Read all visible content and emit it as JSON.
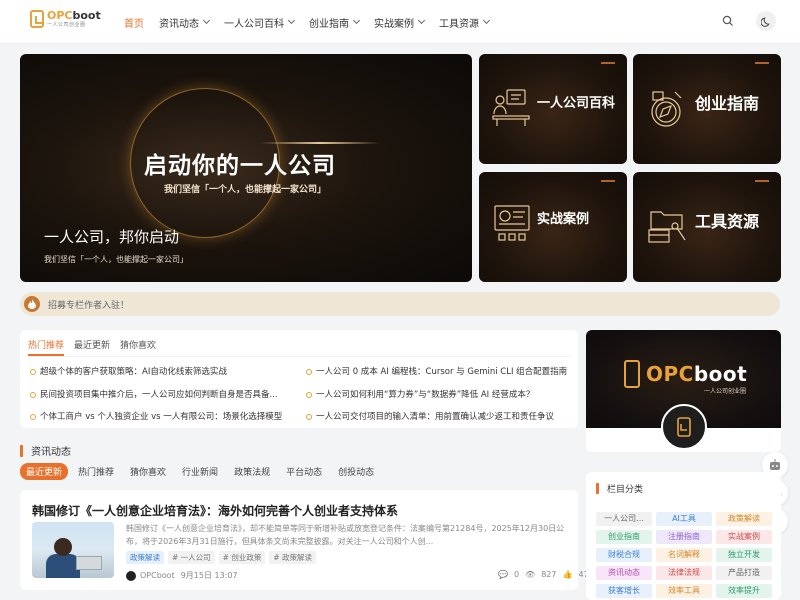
{
  "header": {
    "logo": {
      "brand_prefix": "OPC",
      "brand_suffix": "boot",
      "tagline": "一人公司创业圈"
    },
    "nav": [
      {
        "label": "首页",
        "active": true,
        "has_dropdown": false
      },
      {
        "label": "资讯动态",
        "active": false,
        "has_dropdown": true
      },
      {
        "label": "一人公司百科",
        "active": false,
        "has_dropdown": true
      },
      {
        "label": "创业指南",
        "active": false,
        "has_dropdown": true
      },
      {
        "label": "实战案例",
        "active": false,
        "has_dropdown": true
      },
      {
        "label": "工具资源",
        "active": false,
        "has_dropdown": true
      }
    ],
    "icons": {
      "search": "search-icon",
      "theme": "moon-icon"
    }
  },
  "colors": {
    "accent": "#e8712c",
    "brand_gold": "#e8a23a",
    "banner_dark": "#1c140d"
  },
  "banner": {
    "title": "启动你的一人公司",
    "subtitle": "我们坚信「一个人，也能撑起一家公司」",
    "caption": "一人公司，邦你启动",
    "caption_sub": "我们坚信「一个人，也能撑起一家公司」"
  },
  "tiles": [
    {
      "label": "一人公司百科",
      "icon": "worker-desk-icon"
    },
    {
      "label": "创业指南",
      "icon": "compass-icon"
    },
    {
      "label": "实战案例",
      "icon": "dashboard-icon"
    },
    {
      "label": "工具资源",
      "icon": "toolbox-icon"
    }
  ],
  "notice": {
    "icon": "flame-icon",
    "text": "招募专栏作者入驻！"
  },
  "hot": {
    "tabs": [
      {
        "label": "热门推荐",
        "active": true
      },
      {
        "label": "最近更新",
        "active": false
      },
      {
        "label": "猜你喜欢",
        "active": false
      }
    ],
    "items": [
      "超级个体的客户获取策略：AI自动化线索筛选实战",
      "一人公司 0 成本 AI 编程栈：Cursor 与 Gemini CLI 组合配置指南",
      "民间投资项目集中推介后，一人公司应如何判断自身是否具备...",
      "一人公司如何利用“算力券”与“数据券”降低 AI 经营成本？",
      "个体工商户 vs 个人独资企业 vs 一人有限公司：场景化选择模型",
      "一人公司交付项目的输入清单：用前置确认减少返工和责任争议"
    ]
  },
  "news": {
    "section_title": "资讯动态",
    "tabs": [
      {
        "label": "最近更新",
        "active": true
      },
      {
        "label": "热门推荐",
        "active": false
      },
      {
        "label": "猜你喜欢",
        "active": false
      },
      {
        "label": "行业新闻",
        "active": false
      },
      {
        "label": "政策法规",
        "active": false
      },
      {
        "label": "平台动态",
        "active": false
      },
      {
        "label": "创投动态",
        "active": false
      }
    ],
    "article": {
      "title": "韩国修订《一人创意企业培育法》：海外如何完善个人创业者支持体系",
      "summary": "韩国修订《一人创意企业培育法》，却不能简单等同于新增补贴或放宽登记条件：法案编号第21284号，2025年12月30日公布，将于2026年3月31日施行，但具体条文尚未完整披露。对关注一人公司和个人创...",
      "tags": [
        "政策解读",
        "# 一人公司",
        "# 创业政策",
        "# 政策解读"
      ],
      "author": "OPCboot",
      "date": "9月15日 13:07",
      "comments": "0",
      "views": "827",
      "likes": "47"
    }
  },
  "sidebar": {
    "profile": {
      "brand_prefix": "OPC",
      "brand_suffix": "boot",
      "tagline": "一人公司创业圈"
    },
    "fabs": [
      "robot-icon",
      "wechat-icon",
      "qrcode-icon"
    ],
    "categories": {
      "title": "栏目分类",
      "items": [
        {
          "label": "一人公司...",
          "color": "#666",
          "bg": "#f1f1f1"
        },
        {
          "label": "AI工具",
          "color": "#3d7fd0",
          "bg": "#e7f0fb"
        },
        {
          "label": "政策解读",
          "color": "#d4862a",
          "bg": "#fcf1e2"
        },
        {
          "label": "创业指南",
          "color": "#2f9a6a",
          "bg": "#e3f4ec"
        },
        {
          "label": "注册指南",
          "color": "#8a5fd0",
          "bg": "#efe8fa"
        },
        {
          "label": "实战案例",
          "color": "#d04848",
          "bg": "#fbe7e7"
        },
        {
          "label": "财税合规",
          "color": "#3d7fd0",
          "bg": "#e7f0fb"
        },
        {
          "label": "名词解释",
          "color": "#d4862a",
          "bg": "#fcf1e2"
        },
        {
          "label": "独立开发",
          "color": "#2f9a6a",
          "bg": "#e3f4ec"
        },
        {
          "label": "资讯动态",
          "color": "#b04ab0",
          "bg": "#f8e6f8"
        },
        {
          "label": "法律法规",
          "color": "#d04848",
          "bg": "#fbe7e7"
        },
        {
          "label": "产品打造",
          "color": "#666",
          "bg": "#f1f1f1"
        },
        {
          "label": "获客增长",
          "color": "#3d7fd0",
          "bg": "#e7f0fb"
        },
        {
          "label": "效率工具",
          "color": "#d4862a",
          "bg": "#fcf1e2"
        },
        {
          "label": "效率提升",
          "color": "#2f9a6a",
          "bg": "#e3f4ec"
        }
      ]
    }
  }
}
